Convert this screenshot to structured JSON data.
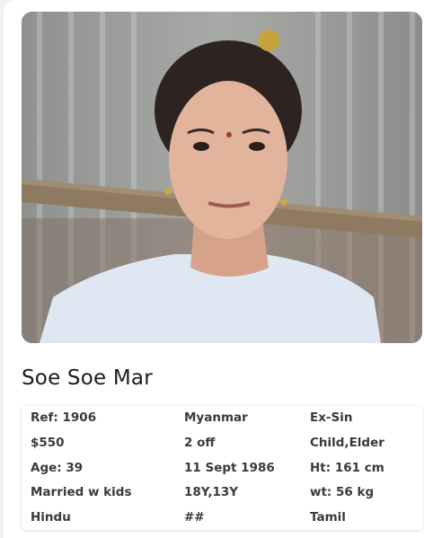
{
  "profile": {
    "name": "Soe Soe Mar",
    "photo": "portrait-photo"
  },
  "details": {
    "rows": [
      [
        "Ref: 1906",
        "Myanmar",
        "Ex-Sin"
      ],
      [
        "$550",
        "2 off",
        "Child,Elder"
      ],
      [
        "Age: 39",
        "11 Sept 1986",
        "Ht: 161 cm"
      ],
      [
        "Married w kids",
        "18Y,13Y",
        "wt: 56 kg"
      ],
      [
        "Hindu",
        "##",
        "Tamil"
      ]
    ]
  }
}
